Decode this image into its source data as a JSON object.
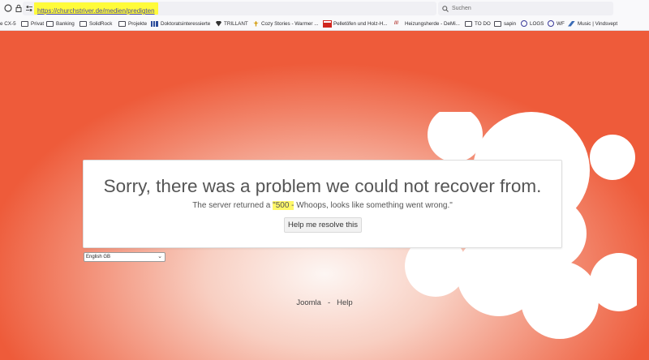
{
  "browser": {
    "url": "https://churchstriver.de/medien/predigten",
    "search_placeholder": "Suchen",
    "bookmarks": [
      {
        "label": "e CX-5",
        "icon": "truncated-icon"
      },
      {
        "label": "Privat",
        "icon": "folder-icon"
      },
      {
        "label": "Banking",
        "icon": "folder-icon"
      },
      {
        "label": "SolidRock",
        "icon": "folder-icon"
      },
      {
        "label": "Projekte",
        "icon": "folder-icon"
      },
      {
        "label": "Doktoratsinteressierte",
        "icon": "bars-icon"
      },
      {
        "label": "TRILLANT",
        "icon": "diamond-icon"
      },
      {
        "label": "Cozy Stories - Warmer ...",
        "icon": "sprout-icon"
      },
      {
        "label": "Pelletöfen und Holz-H...",
        "icon": "flag-icon"
      },
      {
        "label": "Heizungsherde - DeMi...",
        "icon": "hh-icon"
      },
      {
        "label": "TO DO",
        "icon": "folder-icon"
      },
      {
        "label": "sapin",
        "icon": "folder-icon"
      },
      {
        "label": "LOGS",
        "icon": "globe-icon"
      },
      {
        "label": "WF",
        "icon": "globe-icon"
      },
      {
        "label": "Music | Vindsvept",
        "icon": "arrow-icon"
      }
    ]
  },
  "error": {
    "title": "Sorry, there was a problem we could not recover from.",
    "sub_prefix": "The server returned a ",
    "sub_code": "\"500 -",
    "sub_suffix": " Whoops, looks like something went wrong.\"",
    "help_button": "Help me resolve this"
  },
  "language": {
    "selected": "English GB"
  },
  "footer": {
    "link1": "Joomla",
    "separator": "-",
    "link2": "Help"
  },
  "colors": {
    "background_orange": "#ee5b3a",
    "highlight_yellow": "#fffb3a"
  }
}
